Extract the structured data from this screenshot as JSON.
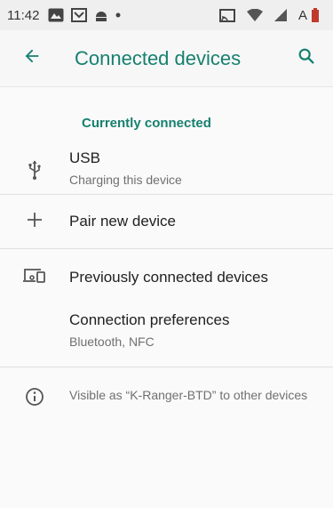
{
  "status_bar": {
    "time": "11:42",
    "battery_label": "A",
    "icons": [
      "gallery-icon",
      "mail-icon",
      "android-icon",
      "dot-icon",
      "cast-icon",
      "wifi-icon",
      "signal-icon",
      "battery-icon"
    ]
  },
  "app_bar": {
    "title": "Connected devices",
    "back_icon": "arrow-back-icon",
    "search_icon": "search-icon"
  },
  "accent_color": "#17806f",
  "section_header": "Currently connected",
  "usb": {
    "title": "USB",
    "subtitle": "Charging this device",
    "icon": "usb-icon"
  },
  "pair": {
    "title": "Pair new device",
    "icon": "plus-icon"
  },
  "previous": {
    "title": "Previously connected devices",
    "icon": "devices-icon"
  },
  "prefs": {
    "title": "Connection preferences",
    "subtitle": "Bluetooth, NFC"
  },
  "footer": {
    "text": "Visible as “K-Ranger-BTD” to other devices",
    "icon": "info-icon"
  }
}
